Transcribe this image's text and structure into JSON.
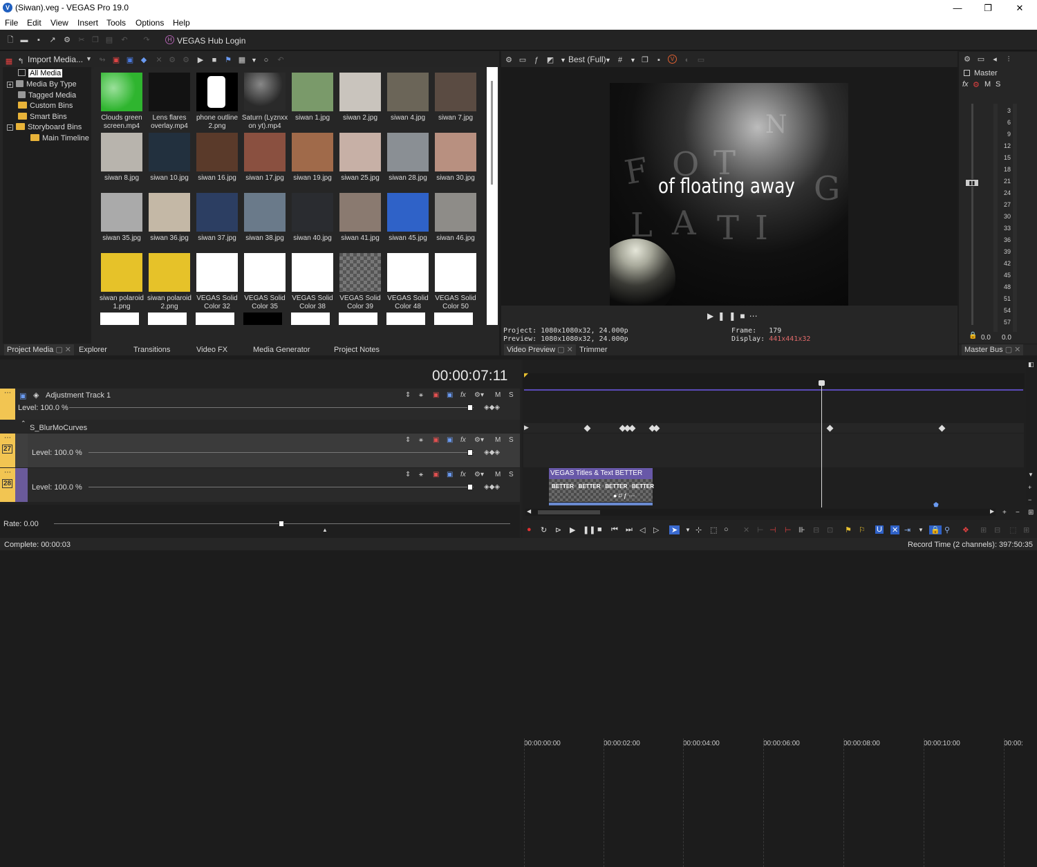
{
  "window": {
    "title": "(Siwan).veg - VEGAS Pro 19.0"
  },
  "menu": [
    "File",
    "Edit",
    "View",
    "Insert",
    "Tools",
    "Options",
    "Help"
  ],
  "toolbar": {
    "hub_label": "VEGAS Hub Login"
  },
  "project_media": {
    "import_label": "Import Media...",
    "tree": [
      {
        "label": "All Media",
        "selected": true
      },
      {
        "label": "Media By Type"
      },
      {
        "label": "Tagged Media"
      },
      {
        "label": "Custom Bins"
      },
      {
        "label": "Smart Bins"
      },
      {
        "label": "Storyboard Bins"
      },
      {
        "label": "Main Timeline"
      }
    ],
    "items": [
      {
        "name": "Clouds green screen.mp4",
        "color": "#3dbd3d"
      },
      {
        "name": "Lens flares overlay.mp4",
        "color": "#121212"
      },
      {
        "name": "phone outline 2.png",
        "color": "#f2f2f2"
      },
      {
        "name": "Saturn (Lyznxx on yt).mp4",
        "color": "#555555"
      },
      {
        "name": "siwan 1.jpg",
        "color": "#7a9a6a"
      },
      {
        "name": "siwan 2.jpg",
        "color": "#c9c4bd"
      },
      {
        "name": "siwan 4.jpg",
        "color": "#6b6558"
      },
      {
        "name": "siwan 7.jpg",
        "color": "#5a4b42"
      },
      {
        "name": "siwan 8.jpg",
        "color": "#b8b4ad"
      },
      {
        "name": "siwan 10.jpg",
        "color": "#22303e"
      },
      {
        "name": "siwan 16.jpg",
        "color": "#5a3a2a"
      },
      {
        "name": "siwan 17.jpg",
        "color": "#8a5040"
      },
      {
        "name": "siwan 19.jpg",
        "color": "#a06a4a"
      },
      {
        "name": "siwan 25.jpg",
        "color": "#c7b0a6"
      },
      {
        "name": "siwan 28.jpg",
        "color": "#8a8f94"
      },
      {
        "name": "siwan 30.jpg",
        "color": "#b89080"
      },
      {
        "name": "siwan 35.jpg",
        "color": "#aaaaaa"
      },
      {
        "name": "siwan 36.jpg",
        "color": "#c4b8a6"
      },
      {
        "name": "siwan 37.jpg",
        "color": "#2c3e62"
      },
      {
        "name": "siwan 38.jpg",
        "color": "#6a7a8a"
      },
      {
        "name": "siwan 40.jpg",
        "color": "#2a2c30"
      },
      {
        "name": "siwan 41.jpg",
        "color": "#8a7a70"
      },
      {
        "name": "siwan 45.jpg",
        "color": "#2f62c8"
      },
      {
        "name": "siwan 46.jpg",
        "color": "#8e8c88"
      },
      {
        "name": "siwan polaroid 1.png",
        "color": "#e6c229"
      },
      {
        "name": "siwan polaroid 2.png",
        "color": "#e6c229"
      },
      {
        "name": "VEGAS Solid Color 32",
        "color": "#ffffff"
      },
      {
        "name": "VEGAS Solid Color 35",
        "color": "#ffffff"
      },
      {
        "name": "VEGAS Solid Color 38",
        "color": "#ffffff"
      },
      {
        "name": "VEGAS Solid Color 39",
        "color": "#777777"
      },
      {
        "name": "VEGAS Solid Color 48",
        "color": "#ffffff"
      },
      {
        "name": "VEGAS Solid Color 50",
        "color": "#ffffff"
      }
    ]
  },
  "dock_tabs": {
    "project_media": "Project Media",
    "explorer": "Explorer",
    "transitions": "Transitions",
    "video_fx": "Video FX",
    "media_generator": "Media Generator",
    "project_notes": "Project Notes",
    "video_preview": "Video Preview",
    "trimmer": "Trimmer",
    "master_bus": "Master Bus"
  },
  "preview": {
    "quality": "Best (Full)",
    "caption": "of floating away",
    "project_label": "Project:",
    "project_value": "1080x1080x32, 24.000p",
    "preview_label": "Preview:",
    "preview_value": "1080x1080x32, 24.000p",
    "frame_label": "Frame:",
    "frame_value": "179",
    "display_label": "Display:",
    "display_value": "441x441x32",
    "display_color": "#e06a6a"
  },
  "mixer": {
    "label": "Master",
    "fx": "fx",
    "m": "M",
    "s": "S",
    "scale": [
      "3",
      "6",
      "9",
      "12",
      "15",
      "18",
      "21",
      "24",
      "27",
      "30",
      "33",
      "36",
      "39",
      "42",
      "45",
      "48",
      "51",
      "54",
      "57"
    ],
    "left_value": "0.0",
    "right_value": "0.0"
  },
  "timeline": {
    "timecode": "00:00:07:11",
    "ruler": [
      "00:00:00:00",
      "00:00:02:00",
      "00:00:04:00",
      "00:00:06:00",
      "00:00:08:00",
      "00:00:10:00",
      "00:00:"
    ],
    "adjustment_track": {
      "name": "Adjustment Track 1",
      "level": "Level: 100.0 %"
    },
    "fx_name": "S_BlurMoCurves",
    "track27": {
      "num": "27",
      "level": "Level: 100.0 %"
    },
    "track28": {
      "num": "28",
      "level": "Level: 100.0 %"
    },
    "clip_title": "VEGAS Titles & Text BETTER",
    "clip_frame": "BETTER",
    "rate": "Rate: 0.00",
    "m": "M",
    "s": "S"
  },
  "status": {
    "left": "Complete: 00:00:03",
    "right": "Record Time (2 channels): 397:50:35"
  }
}
